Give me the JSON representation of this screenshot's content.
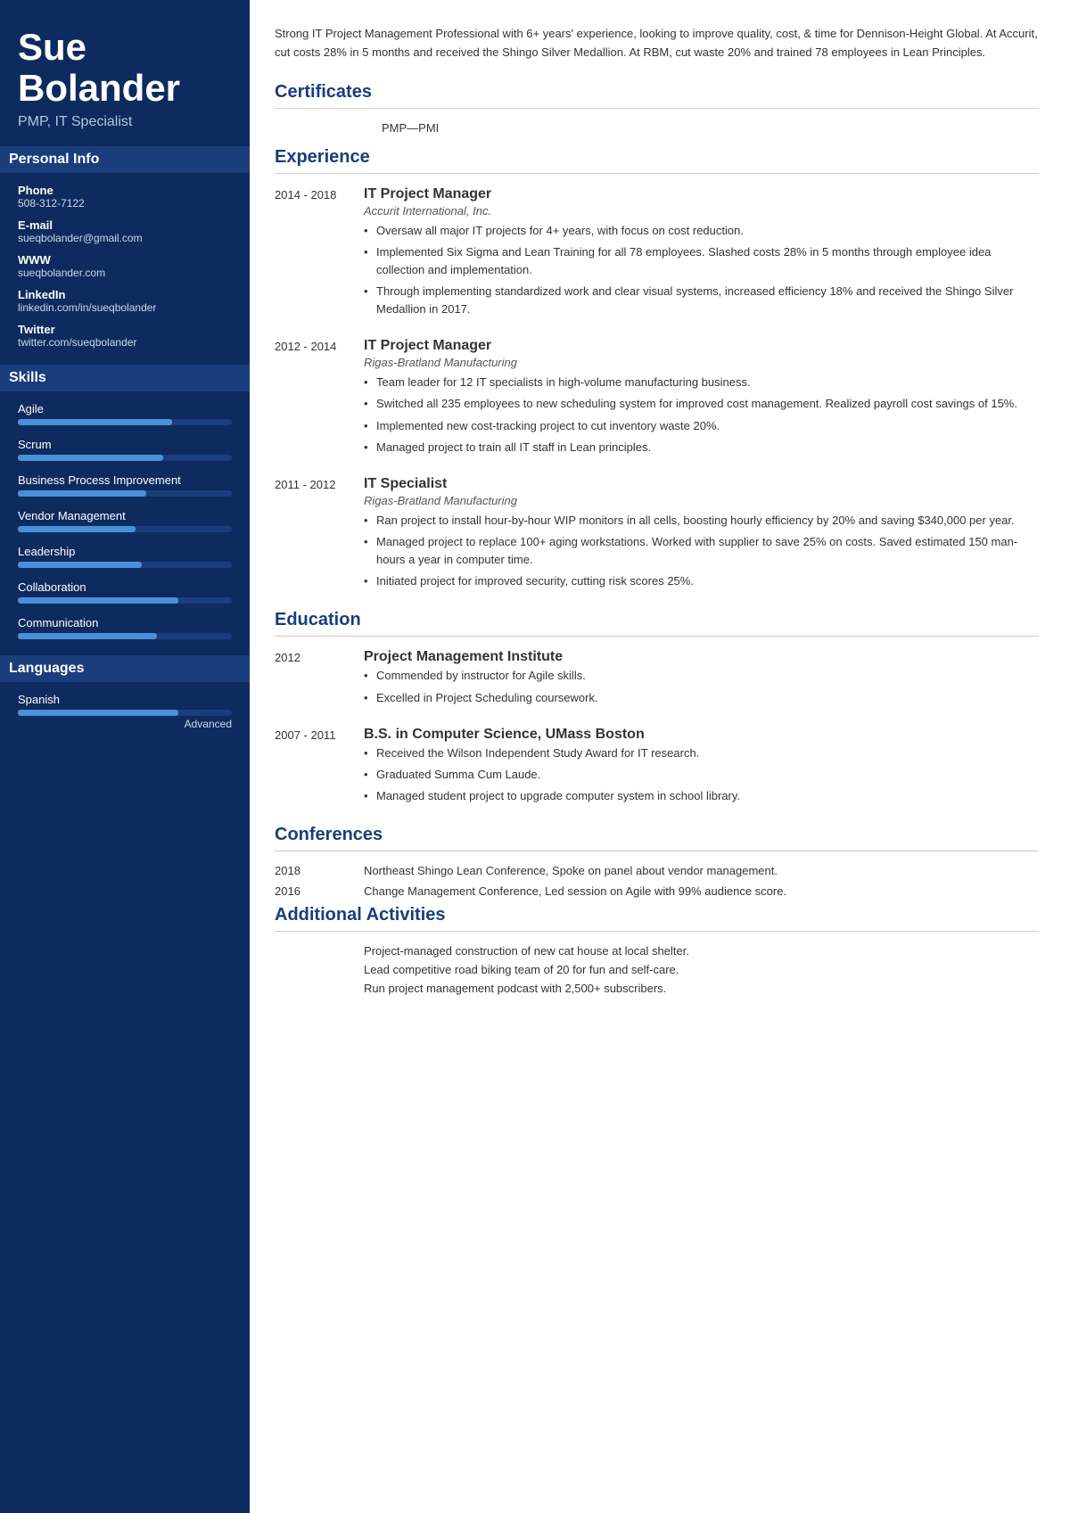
{
  "name": {
    "first": "Sue",
    "last": "Bolander",
    "title": "PMP, IT Specialist"
  },
  "sidebar": {
    "personal_info_heading": "Personal Info",
    "phone_label": "Phone",
    "phone_value": "508-312-7122",
    "email_label": "E-mail",
    "email_value": "sueqbolander@gmail.com",
    "www_label": "WWW",
    "www_value": "sueqbolander.com",
    "linkedin_label": "LinkedIn",
    "linkedin_value": "linkedin.com/in/sueqbolander",
    "twitter_label": "Twitter",
    "twitter_value": "twitter.com/sueqbolander",
    "skills_heading": "Skills",
    "skills": [
      {
        "name": "Agile",
        "pct": 72
      },
      {
        "name": "Scrum",
        "pct": 68
      },
      {
        "name": "Business Process Improvement",
        "pct": 60
      },
      {
        "name": "Vendor Management",
        "pct": 55
      },
      {
        "name": "Leadership",
        "pct": 58
      },
      {
        "name": "Collaboration",
        "pct": 75
      },
      {
        "name": "Communication",
        "pct": 65
      }
    ],
    "languages_heading": "Languages",
    "languages": [
      {
        "name": "Spanish",
        "pct": 75,
        "level": "Advanced"
      }
    ]
  },
  "main": {
    "summary": "Strong IT Project Management Professional with 6+ years' experience, looking to improve quality, cost, & time for Dennison-Height Global. At Accurit, cut costs 28% in 5 months and received the Shingo Silver Medallion. At RBM, cut waste 20% and trained 78 employees in Lean Principles.",
    "certificates_heading": "Certificates",
    "certificates": [
      {
        "value": "PMP—PMI"
      }
    ],
    "experience_heading": "Experience",
    "experience": [
      {
        "date": "2014 - 2018",
        "title": "IT Project Manager",
        "subtitle": "Accurit International, Inc.",
        "bullets": [
          "Oversaw all major IT projects for 4+ years, with focus on cost reduction.",
          "Implemented Six Sigma and Lean Training for all 78 employees. Slashed costs 28% in 5 months through employee idea collection and implementation.",
          "Through implementing standardized work and clear visual systems, increased efficiency 18% and received the Shingo Silver Medallion in 2017."
        ]
      },
      {
        "date": "2012 - 2014",
        "title": "IT Project Manager",
        "subtitle": "Rigas-Bratland Manufacturing",
        "bullets": [
          "Team leader for 12 IT specialists in high-volume manufacturing business.",
          "Switched all 235 employees to new scheduling system for improved cost management. Realized payroll cost savings of 15%.",
          "Implemented new cost-tracking project to cut inventory waste 20%.",
          "Managed project to train all IT staff in Lean principles."
        ]
      },
      {
        "date": "2011 - 2012",
        "title": "IT Specialist",
        "subtitle": "Rigas-Bratland Manufacturing",
        "bullets": [
          "Ran project to install hour-by-hour WIP monitors in all cells, boosting hourly efficiency by 20% and saving $340,000 per year.",
          "Managed project to replace 100+ aging workstations. Worked with supplier to save 25% on costs. Saved estimated 150 man-hours a year in computer time.",
          "Initiated project for improved security, cutting risk scores 25%."
        ]
      }
    ],
    "education_heading": "Education",
    "education": [
      {
        "date": "2012",
        "title": "Project Management Institute",
        "subtitle": "",
        "bullets": [
          "Commended by instructor for Agile skills.",
          "Excelled in Project Scheduling coursework."
        ]
      },
      {
        "date": "2007 - 2011",
        "title": "B.S. in Computer Science, UMass Boston",
        "subtitle": "",
        "bullets": [
          "Received the Wilson Independent Study Award for IT research.",
          "Graduated Summa Cum Laude.",
          "Managed student project to upgrade computer system in school library."
        ]
      }
    ],
    "conferences_heading": "Conferences",
    "conferences": [
      {
        "date": "2018",
        "text": "Northeast Shingo Lean Conference, Spoke on panel about vendor management."
      },
      {
        "date": "2016",
        "text": "Change Management Conference, Led session on Agile with 99% audience score."
      }
    ],
    "activities_heading": "Additional Activities",
    "activities": [
      "Project-managed construction of new cat house at local shelter.",
      "Lead competitive road biking team of 20 for fun and self-care.",
      "Run project management podcast with 2,500+ subscribers."
    ]
  }
}
